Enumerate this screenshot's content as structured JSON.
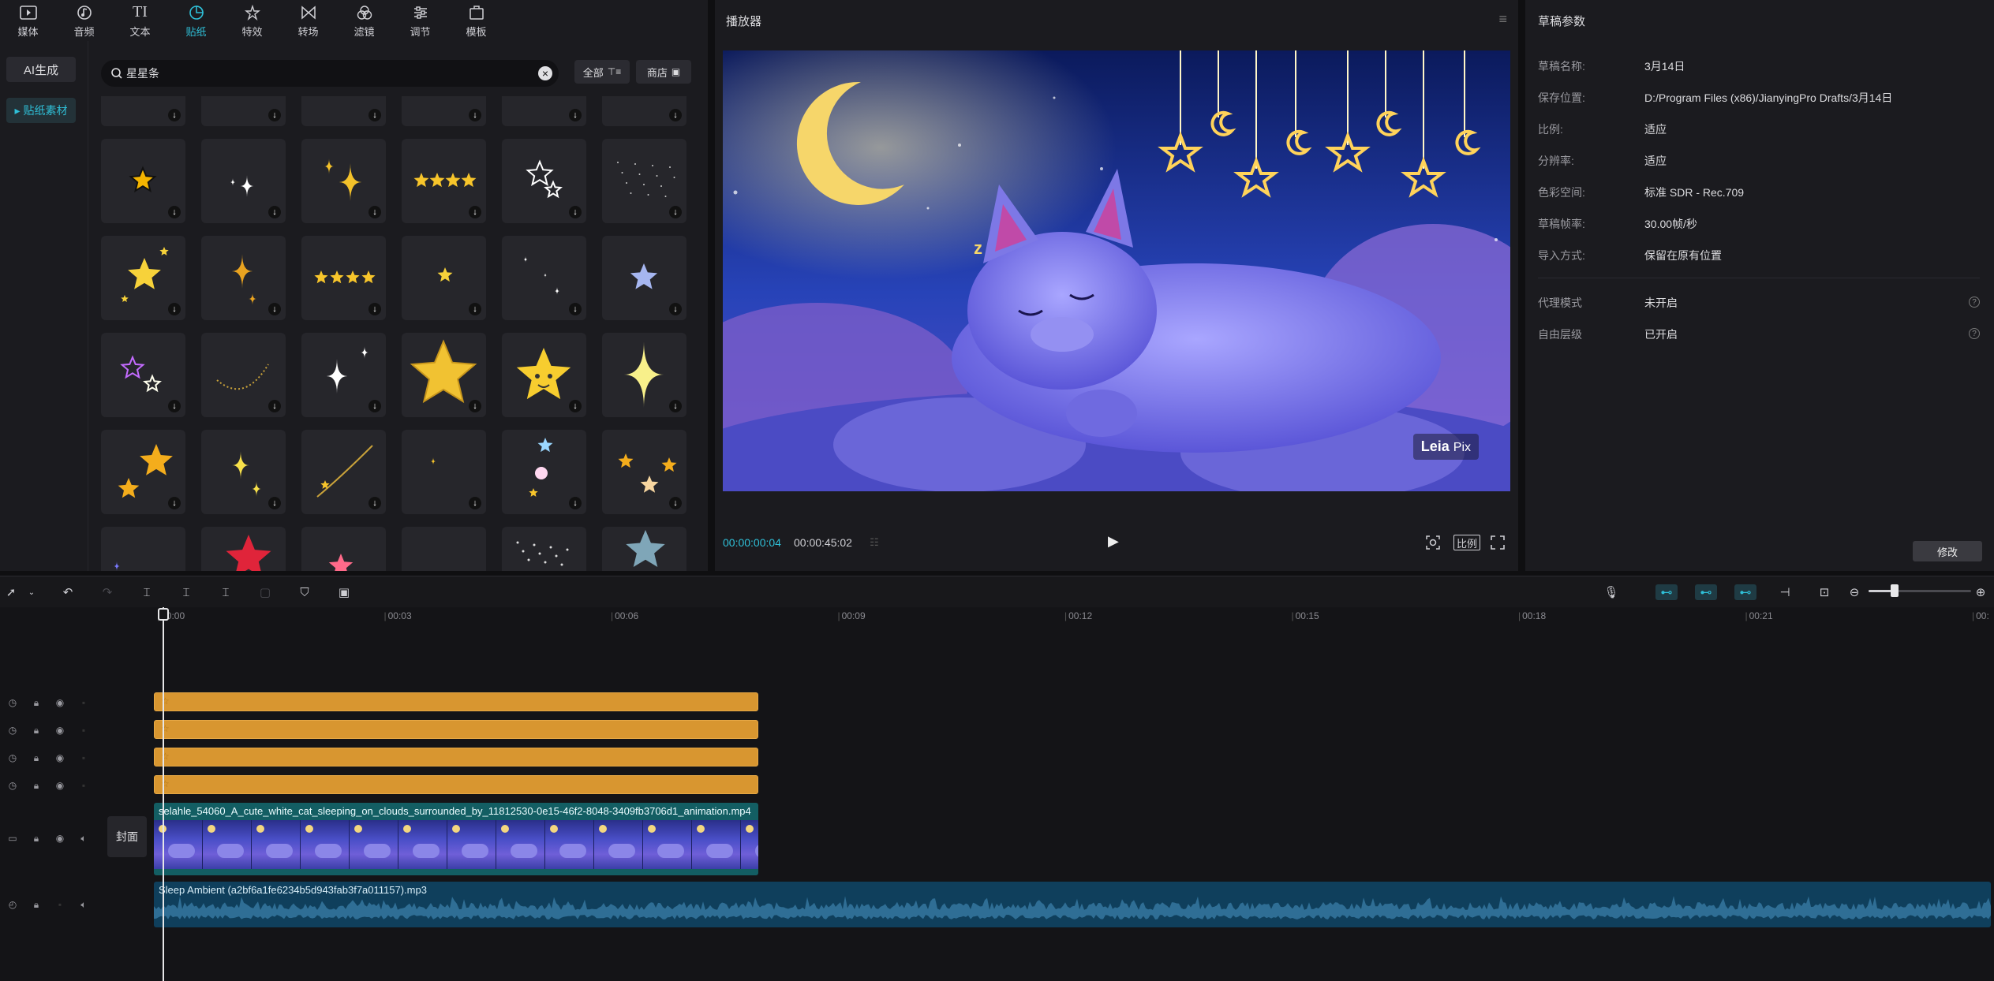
{
  "top_tabs": [
    {
      "label": "媒体",
      "icon": "media-icon"
    },
    {
      "label": "音频",
      "icon": "audio-icon"
    },
    {
      "label": "文本",
      "icon": "text-icon"
    },
    {
      "label": "贴纸",
      "icon": "sticker-icon",
      "active": true
    },
    {
      "label": "特效",
      "icon": "effects-icon"
    },
    {
      "label": "转场",
      "icon": "transition-icon"
    },
    {
      "label": "滤镜",
      "icon": "filter-icon"
    },
    {
      "label": "调节",
      "icon": "adjust-icon"
    },
    {
      "label": "模板",
      "icon": "template-icon"
    }
  ],
  "sidebar": {
    "ai_label": "AI生成",
    "sticker_label": "▸ 贴纸素材"
  },
  "search": {
    "query": "星星条",
    "all_label": "全部",
    "shop_label": "商店"
  },
  "player": {
    "title": "播放器",
    "current_time": "00:00:00:04",
    "total_time": "00:00:45:02",
    "ratio_label": "比例",
    "watermark": "Leia",
    "watermark_suffix": "Pix"
  },
  "draft": {
    "title": "草稿参数",
    "rows": [
      {
        "k": "草稿名称:",
        "v": "3月14日"
      },
      {
        "k": "保存位置:",
        "v": "D:/Program Files (x86)/JianyingPro Drafts/3月14日"
      },
      {
        "k": "比例:",
        "v": "适应"
      },
      {
        "k": "分辨率:",
        "v": "适应"
      },
      {
        "k": "色彩空间:",
        "v": "标准 SDR - Rec.709"
      },
      {
        "k": "草稿帧率:",
        "v": "30.00帧/秒"
      },
      {
        "k": "导入方式:",
        "v": "保留在原有位置"
      }
    ],
    "rows2": [
      {
        "k": "代理模式",
        "v": "未开启"
      },
      {
        "k": "自由层级",
        "v": "已开启"
      }
    ],
    "modify_label": "修改"
  },
  "timeline": {
    "ticks": [
      "00:00",
      "00:03",
      "00:06",
      "00:09",
      "00:12",
      "00:15",
      "00:18",
      "00:21",
      "00:"
    ],
    "cover_label": "封面",
    "video_clip_name": "selahle_54060_A_cute_white_cat_sleeping_on_clouds_surrounded_by_11812530-0e15-46f2-8048-3409fb3706d1_animation.mp4",
    "audio_clip_name": "Sleep Ambient (a2bf6a1fe6234b5d943fab3f7a011157).mp3"
  },
  "colors": {
    "accent": "#2fc0d8",
    "sticker_clip": "#d89630",
    "video_clip": "#135e63",
    "audio_clip": "#0f3f5c"
  }
}
